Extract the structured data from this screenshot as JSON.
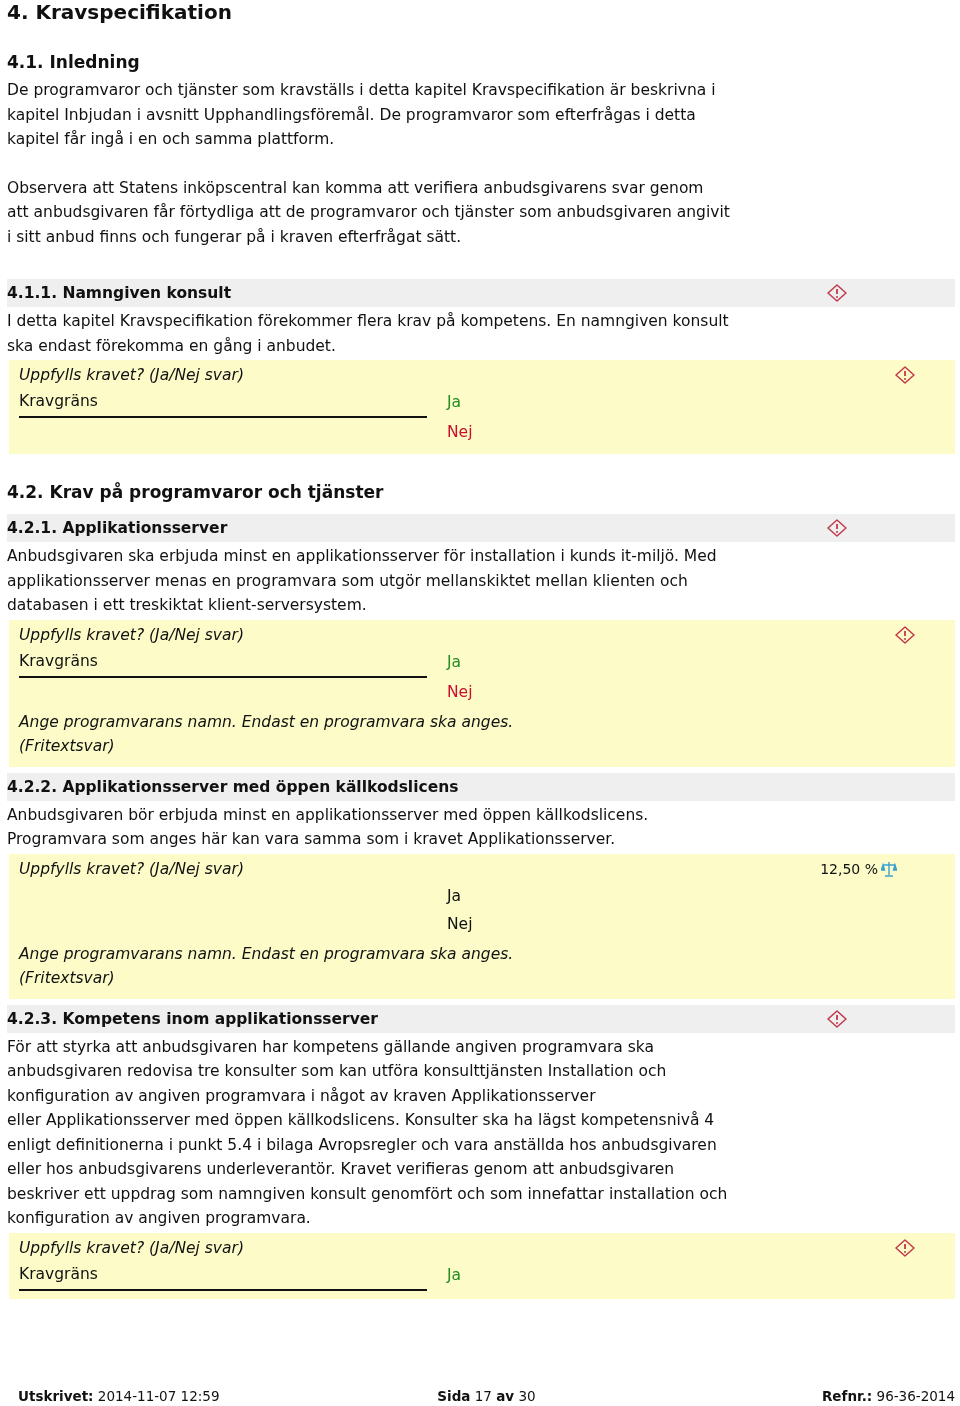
{
  "title": "4. Kravspecifikation",
  "sections": [
    {
      "heading": "4.1. Inledning",
      "paragraphs": [
        "De programvaror och tjänster som kravställs i detta kapitel Kravspecifikation är beskrivna i\nkapitel Inbjudan i avsnitt Upphandlingsföremål. De programvaror som efterfrågas i detta\nkapitel får ingå i en och samma plattform.",
        "Observera att Statens inköpscentral kan komma att verifiera anbudsgivarens svar genom\natt anbudsgivaren får förtydliga att de programvaror och tjänster som anbudsgivaren angivit\ni sitt anbud finns och fungerar på i kraven efterfrågat sätt."
      ],
      "requirements": [
        {
          "heading": "4.1.1. Namngiven konsult",
          "warning": true,
          "paragraphs": [
            "I detta kapitel Kravspecifikation förekommer flera krav på kompetens. En namngiven konsult\nska endast förekomma en gång i anbudet."
          ],
          "answers": [
            {
              "question": "Uppfylls kravet? (Ja/Nej svar)",
              "marker": {
                "kind": "warning"
              },
              "threshold": "Kravgräns",
              "options": [
                {
                  "label": "Ja",
                  "color": "#228b22"
                },
                {
                  "label": "Nej",
                  "color": "#c8102e"
                }
              ]
            }
          ]
        }
      ]
    },
    {
      "heading": "4.2. Krav på programvaror och tjänster",
      "requirements": [
        {
          "heading": "4.2.1. Applikationsserver",
          "warning": true,
          "paragraphs": [
            "Anbudsgivaren ska erbjuda minst en applikationsserver för installation i kunds it-miljö. Med\napplikationsserver menas en programvara som utgör mellanskiktet mellan klienten och\ndatabasen i ett treskiktat klient-serversystem."
          ],
          "answers": [
            {
              "question": "Uppfylls kravet? (Ja/Nej svar)",
              "marker": {
                "kind": "warning"
              },
              "threshold": "Kravgräns",
              "options": [
                {
                  "label": "Ja",
                  "color": "#228b22"
                },
                {
                  "label": "Nej",
                  "color": "#c8102e"
                }
              ],
              "freetext": "Ange programvarans namn. Endast en programvara ska anges.\n(Fritextsvar)"
            }
          ]
        },
        {
          "heading": "4.2.2. Applikationsserver med öppen källkodslicens",
          "warning": false,
          "paragraphs": [
            "Anbudsgivaren bör erbjuda minst en applikationsserver med öppen källkodslicens.\nProgramvara som anges här kan vara samma som i kravet Applikationsserver."
          ],
          "answers": [
            {
              "question": "Uppfylls kravet? (Ja/Nej svar)",
              "marker": {
                "kind": "weight",
                "text": "12,50 %"
              },
              "options": [
                {
                  "label": "Ja",
                  "color": "#111111"
                },
                {
                  "label": "Nej",
                  "color": "#111111"
                }
              ],
              "freetext": "Ange programvarans namn. Endast en programvara ska anges.\n(Fritextsvar)"
            }
          ]
        },
        {
          "heading": "4.2.3. Kompetens inom applikationsserver",
          "warning": true,
          "paragraphs": [
            "För att styrka att anbudsgivaren har kompetens gällande angiven programvara ska\nanbudsgivaren redovisa tre konsulter som kan utföra konsulttjänsten Installation och\nkonfiguration av angiven programvara i något av kraven Applikationsserver\neller Applikationsserver med öppen källkodslicens. Konsulter ska ha lägst kompetensnivå 4\nenligt definitionerna i punkt 5.4 i bilaga Avropsregler och vara anställda hos anbudsgivaren\neller hos anbudsgivarens underleverantör. Kravet verifieras genom att anbudsgivaren\nbeskriver ett uppdrag som namngiven konsult genomfört och som innefattar installation och\nkonfiguration av angiven programvara."
          ],
          "answers": [
            {
              "question": "Uppfylls kravet? (Ja/Nej svar)",
              "marker": {
                "kind": "warning"
              },
              "threshold": "Kravgräns",
              "options": [
                {
                  "label": "Ja",
                  "color": "#228b22"
                }
              ]
            }
          ]
        }
      ]
    }
  ],
  "footer": {
    "printed": "**Utskrivet:** 2014-11-07 12:59",
    "page": "**Sida** 17 **av** 30",
    "reference": "**Refnr.:** 96-36-2014"
  }
}
